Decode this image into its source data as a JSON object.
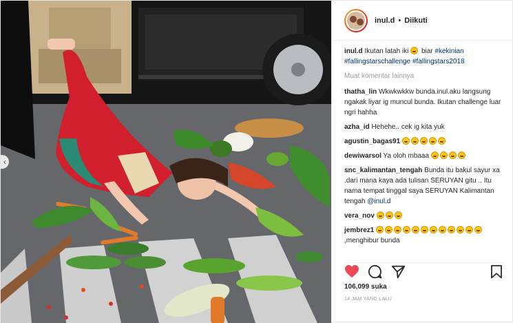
{
  "post": {
    "username": "inul.d",
    "follow_status": "Diikuti",
    "caption": {
      "username": "inul.d",
      "text_before": "Ikutan latah iki",
      "text_after": "biar",
      "hashtags": [
        "#kekinian",
        "#fallingstarschallenge",
        "#fallingstars2018"
      ]
    },
    "load_more_comments": "Muat komentar lainnya",
    "comments": [
      {
        "user": "thatha_lin",
        "text": "Wkwkwkkw bunda.inul.aku langsung ngakak liyar ig muncul bunda. Ikutan challenge luar ngri hahha"
      },
      {
        "user": "azha_id",
        "text": "Hehehe.. cek ig kita yuk"
      },
      {
        "user": "agustin_bagas91",
        "text": "",
        "emoji_count": 5
      },
      {
        "user": "dewiwarsol",
        "text": "Ya oloh mbaaa",
        "emoji_count": 4
      },
      {
        "user": "snc_kalimantan_tengah",
        "text": "Bunda itu bakul sayur xa .dari mana kaya ada tulisan SERUYAN gitu .. Itu nama tempat tinggal saya SERUYAN Kalimantan tengah",
        "mention": "@inul.d"
      },
      {
        "user": "vera_nov",
        "text": "",
        "emoji_count": 3
      },
      {
        "user": "jembrez1",
        "text": ",menghibur bunda",
        "emoji_count_before": 12
      }
    ],
    "likes": "106,099 suka",
    "timestamp": "14 JAM YANG LALU",
    "icons": {
      "like": "heart-icon",
      "comment": "comment-icon",
      "share": "share-icon",
      "save": "bookmark-icon"
    },
    "colors": {
      "like_red": "#ed4956",
      "hashtag_blue": "#003569",
      "muted_gray": "#999999"
    }
  }
}
